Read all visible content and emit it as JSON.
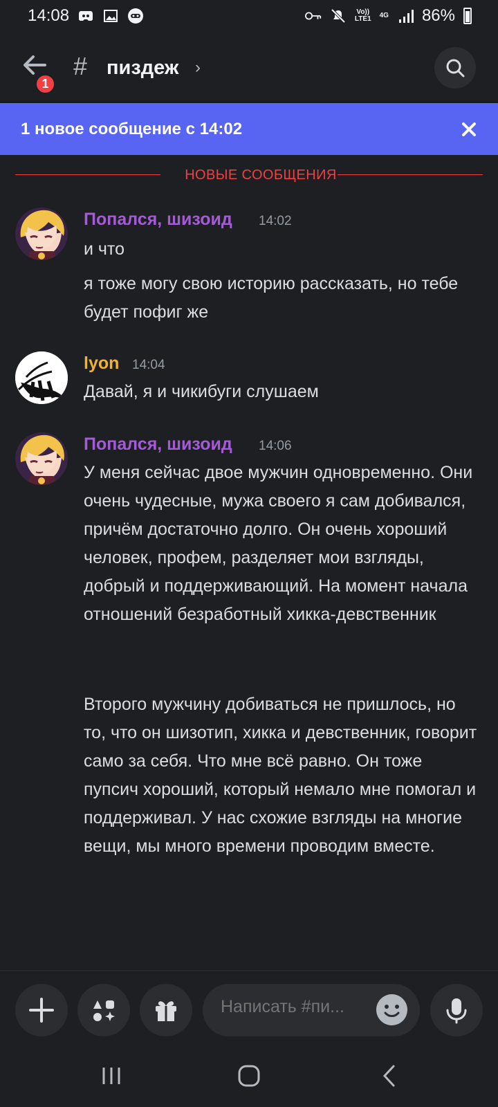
{
  "status_bar": {
    "time": "14:08",
    "network_top": "Vo))",
    "network_bottom": "LTE1",
    "signal_type": "4G",
    "battery": "86%"
  },
  "header": {
    "notification_count": "1",
    "hash": "#",
    "channel_name": "пиздеж",
    "chevron": "›"
  },
  "new_messages_banner": {
    "text": "1 новое сообщение с 14:02"
  },
  "divider": {
    "label": "НОВЫЕ СООБЩЕНИЯ"
  },
  "messages": [
    {
      "author": "Попался, шизоид",
      "author_color": "#a45bd6",
      "timestamp": "14:02",
      "paragraphs": [
        "и что",
        "я тоже могу свою историю рассказать, но тебе будет пофиг же"
      ]
    },
    {
      "author": "lyon",
      "author_color": "#f0b232",
      "timestamp": "14:04",
      "paragraphs": [
        "Давай, я и чикибуги слушаем"
      ]
    },
    {
      "author": "Попался, шизоид",
      "author_color": "#a45bd6",
      "timestamp": "14:06",
      "paragraphs": [
        "У меня сейчас двое мужчин одновременно. Они очень чудесные, мужа своего я сам добивался, причём достаточно долго. Он очень хороший человек, профем, разделяет мои взгляды, добрый и поддерживающий. На момент начала отношений безработный хикка-девственник",
        "Второго мужчину добиваться не пришлось, но то, что он шизотип, хикка и девственник, говорит само за себя. Что мне всё равно. Он тоже пупсич хороший, который немало мне помогал и поддерживал. У нас схожие взгляды на многие вещи, мы много времени проводим вместе."
      ]
    }
  ],
  "composer": {
    "placeholder": "Написать #пи..."
  },
  "colors": {
    "background": "#1e1f22",
    "accent": "#5865f2",
    "new_divider": "#f23f42"
  },
  "icons": {
    "back": "back-arrow-icon",
    "search": "search-icon",
    "close": "close-icon",
    "add": "plus-icon",
    "apps": "apps-icon",
    "gift": "gift-icon",
    "emoji": "emoji-icon",
    "mic": "microphone-icon"
  }
}
